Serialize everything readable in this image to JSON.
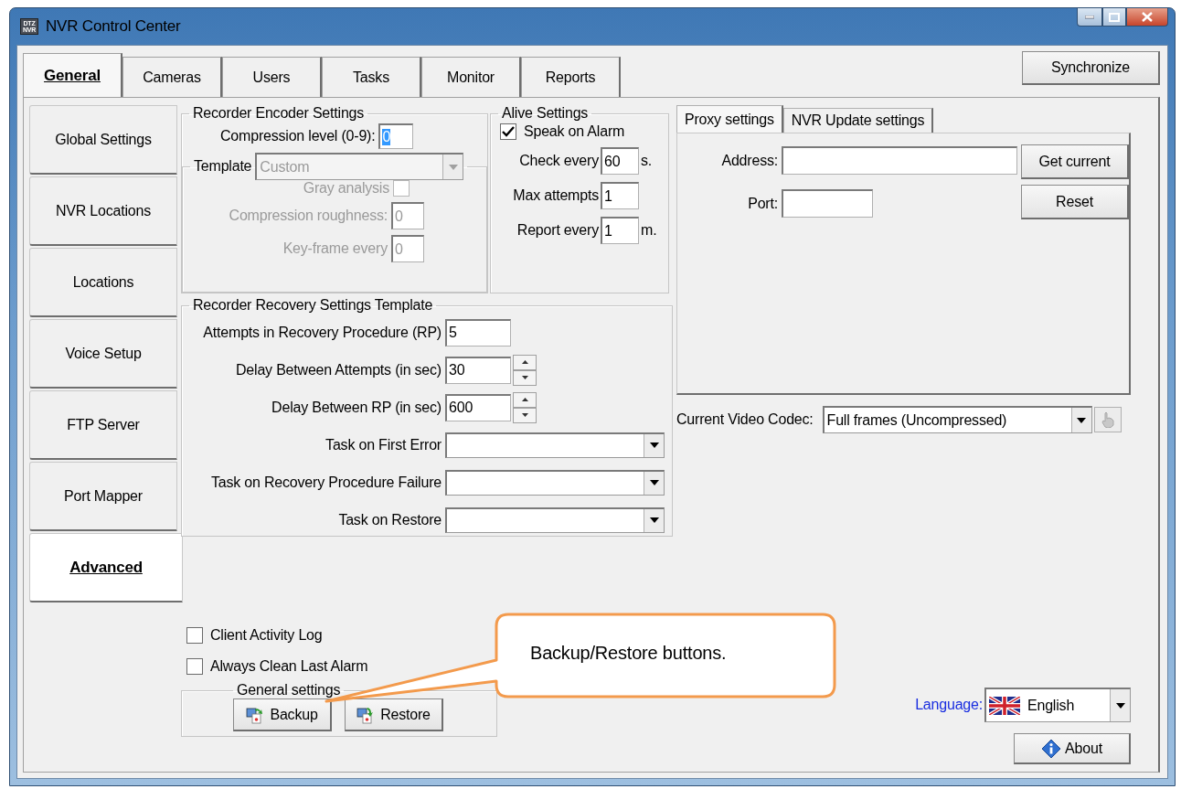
{
  "window": {
    "title": "NVR Control Center",
    "logo_lines": [
      "DTZ",
      "NVR"
    ]
  },
  "tabs": [
    {
      "label": "General",
      "selected": true
    },
    {
      "label": "Cameras",
      "selected": false
    },
    {
      "label": "Users",
      "selected": false
    },
    {
      "label": "Tasks",
      "selected": false
    },
    {
      "label": "Monitor",
      "selected": false
    },
    {
      "label": "Reports",
      "selected": false
    }
  ],
  "synchronize_button": "Synchronize",
  "side_tabs": [
    {
      "label": "Global Settings",
      "selected": false
    },
    {
      "label": "NVR Locations",
      "selected": false
    },
    {
      "label": "Locations",
      "selected": false
    },
    {
      "label": "Voice Setup",
      "selected": false
    },
    {
      "label": "FTP Server",
      "selected": false
    },
    {
      "label": "Port Mapper",
      "selected": false
    },
    {
      "label": "Advanced",
      "selected": true
    }
  ],
  "encoder": {
    "title": "Recorder Encoder Settings",
    "compression": {
      "label": "Compression level (0-9):",
      "value": "0",
      "value_selected": true
    },
    "template": {
      "label": "Template",
      "value": "Custom",
      "disabled": true,
      "gray_analysis": {
        "label": "Gray analysis",
        "checked": false
      },
      "fields": [
        {
          "label": "Compression roughness:",
          "value": "0"
        },
        {
          "label": "Key-frame every",
          "value": "0"
        }
      ]
    }
  },
  "alive": {
    "title": "Alive Settings",
    "speak": {
      "label": "Speak on Alarm",
      "checked": true
    },
    "rows": [
      {
        "label": "Check every",
        "value": "60",
        "unit": "s."
      },
      {
        "label": "Max attempts",
        "value": "1"
      },
      {
        "label": "Report every",
        "value": "1",
        "unit": "m."
      }
    ]
  },
  "recovery": {
    "title": "Recorder Recovery Settings Template",
    "rows": [
      {
        "kind": "text",
        "label": "Attempts in Recovery Procedure (RP)",
        "value": "5"
      },
      {
        "kind": "spin",
        "label": "Delay Between Attempts (in sec)",
        "value": "30"
      },
      {
        "kind": "spin",
        "label": "Delay Between RP (in sec)",
        "value": "600"
      },
      {
        "kind": "select",
        "label": "Task on First Error"
      },
      {
        "kind": "select",
        "label": "Task on Recovery Procedure Failure"
      },
      {
        "kind": "select",
        "label": "Task on Restore"
      }
    ]
  },
  "proxy": {
    "tabs": [
      {
        "label": "Proxy settings",
        "selected": true
      },
      {
        "label": "NVR Update settings",
        "selected": false
      }
    ],
    "fields": [
      {
        "label": "Address:",
        "kind": "wide"
      },
      {
        "label": "Port:",
        "kind": "short"
      }
    ],
    "buttons": [
      "Get current",
      "Reset"
    ]
  },
  "codec": {
    "label": "Current Video Codec:",
    "value": "Full frames (Uncompressed)"
  },
  "options": [
    {
      "label": "Client Activity Log",
      "checked": false
    },
    {
      "label": "Always Clean Last Alarm",
      "checked": false
    }
  ],
  "general_settings": {
    "title": "General settings",
    "buttons": [
      {
        "kind": "backup",
        "label": "Backup"
      },
      {
        "kind": "restore",
        "label": "Restore"
      }
    ]
  },
  "language": {
    "label": "Language:",
    "value": "English"
  },
  "about_button": "About",
  "callout": {
    "text": "Backup/Restore buttons."
  }
}
